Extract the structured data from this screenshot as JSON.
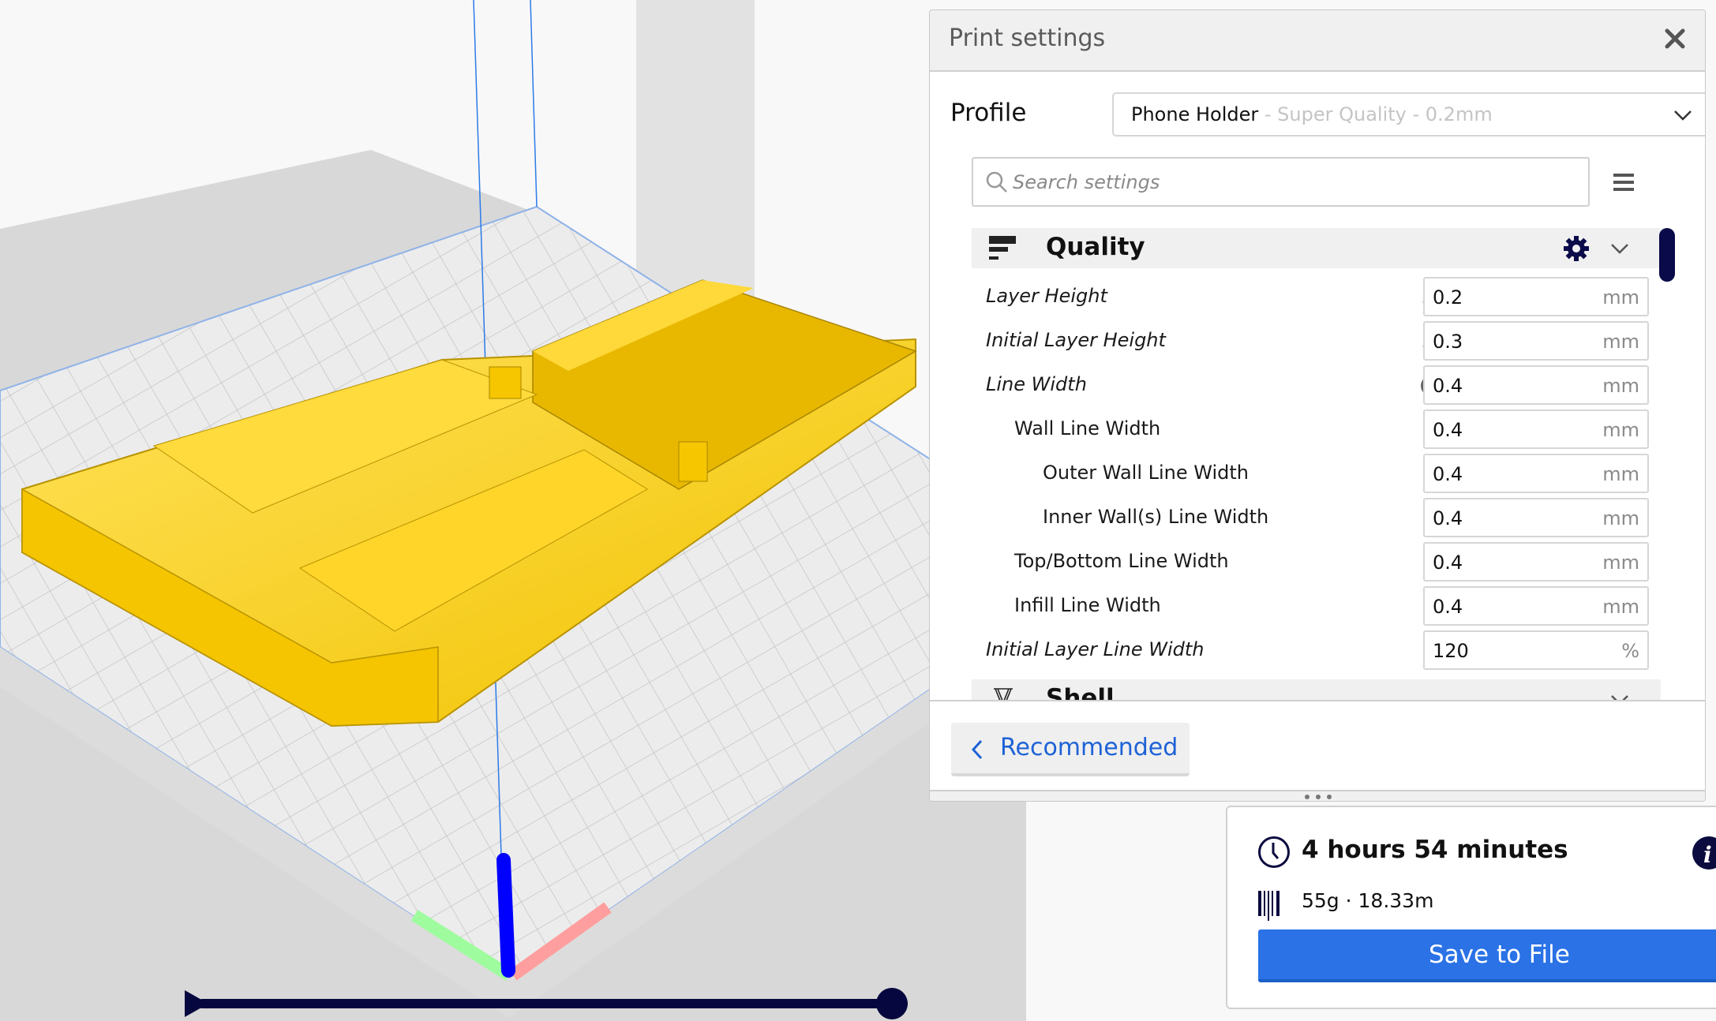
{
  "viewport": {
    "model_name": "Phone Holder",
    "model_color": "#f5c800",
    "axis_colors": {
      "x": "#ff9e9e",
      "y": "#9eff9e",
      "z": "#0000ff"
    }
  },
  "print_settings": {
    "title": "Print settings",
    "profile_label": "Profile",
    "profile": {
      "name": "Phone Holder",
      "suffix": " - Super Quality - 0.2mm"
    },
    "search": {
      "placeholder": "Search settings",
      "value": ""
    },
    "categories": [
      {
        "label": "Quality",
        "expanded": true,
        "settings": [
          {
            "label": "Layer Height",
            "value": "0.2",
            "unit": "mm",
            "italic": true,
            "indent": 0,
            "state_icon": "link-icon"
          },
          {
            "label": "Initial Layer Height",
            "value": "0.3",
            "unit": "mm",
            "italic": true,
            "indent": 0,
            "state_icon": "link-icon"
          },
          {
            "label": "Line Width",
            "value": "0.4",
            "unit": "mm",
            "italic": true,
            "indent": 0,
            "state_icon": "function-icon"
          },
          {
            "label": "Wall Line Width",
            "value": "0.4",
            "unit": "mm",
            "italic": false,
            "indent": 1,
            "state_icon": null
          },
          {
            "label": "Outer Wall Line Width",
            "value": "0.4",
            "unit": "mm",
            "italic": false,
            "indent": 2,
            "state_icon": null
          },
          {
            "label": "Inner Wall(s) Line Width",
            "value": "0.4",
            "unit": "mm",
            "italic": false,
            "indent": 2,
            "state_icon": null
          },
          {
            "label": "Top/Bottom Line Width",
            "value": "0.4",
            "unit": "mm",
            "italic": false,
            "indent": 1,
            "state_icon": null
          },
          {
            "label": "Infill Line Width",
            "value": "0.4",
            "unit": "mm",
            "italic": false,
            "indent": 1,
            "state_icon": null
          },
          {
            "label": "Initial Layer Line Width",
            "value": "120",
            "unit": "%",
            "italic": true,
            "indent": 0,
            "state_icon": null
          }
        ]
      },
      {
        "label": "Shell",
        "expanded": false,
        "settings": []
      }
    ],
    "recommended_label": "Recommended"
  },
  "summary": {
    "print_time": "4 hours 54 minutes",
    "material": "55g · 18.33m",
    "save_label": "Save to File"
  },
  "playback": {
    "progress": 1.0
  }
}
